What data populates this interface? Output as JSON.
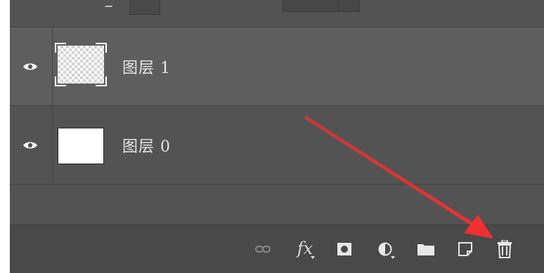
{
  "layers_panel": {
    "layers": [
      {
        "name": "图层 1",
        "thumbnail": "transparent-checkerboard",
        "selected": true,
        "visible": true
      },
      {
        "name": "图层 0",
        "thumbnail": "white-fill",
        "selected": false,
        "visible": true
      }
    ],
    "toolbar": {
      "buttons": [
        {
          "icon": "link-layers-icon"
        },
        {
          "icon": "fx-icon",
          "label": "fx"
        },
        {
          "icon": "add-mask-icon"
        },
        {
          "icon": "adjustment-layer-icon"
        },
        {
          "icon": "new-group-folder-icon"
        },
        {
          "icon": "new-layer-icon"
        },
        {
          "icon": "delete-layer-trash-icon"
        }
      ]
    }
  },
  "annotation": {
    "type": "arrow",
    "color": "#f03030",
    "points_to": "delete-layer-trash-icon"
  },
  "colors": {
    "panel_bg": "#535353",
    "selected_row_bg": "#5e5e5e",
    "toolbar_bg": "#494949",
    "text": "#e6e6e6",
    "arrow": "#f03030"
  }
}
